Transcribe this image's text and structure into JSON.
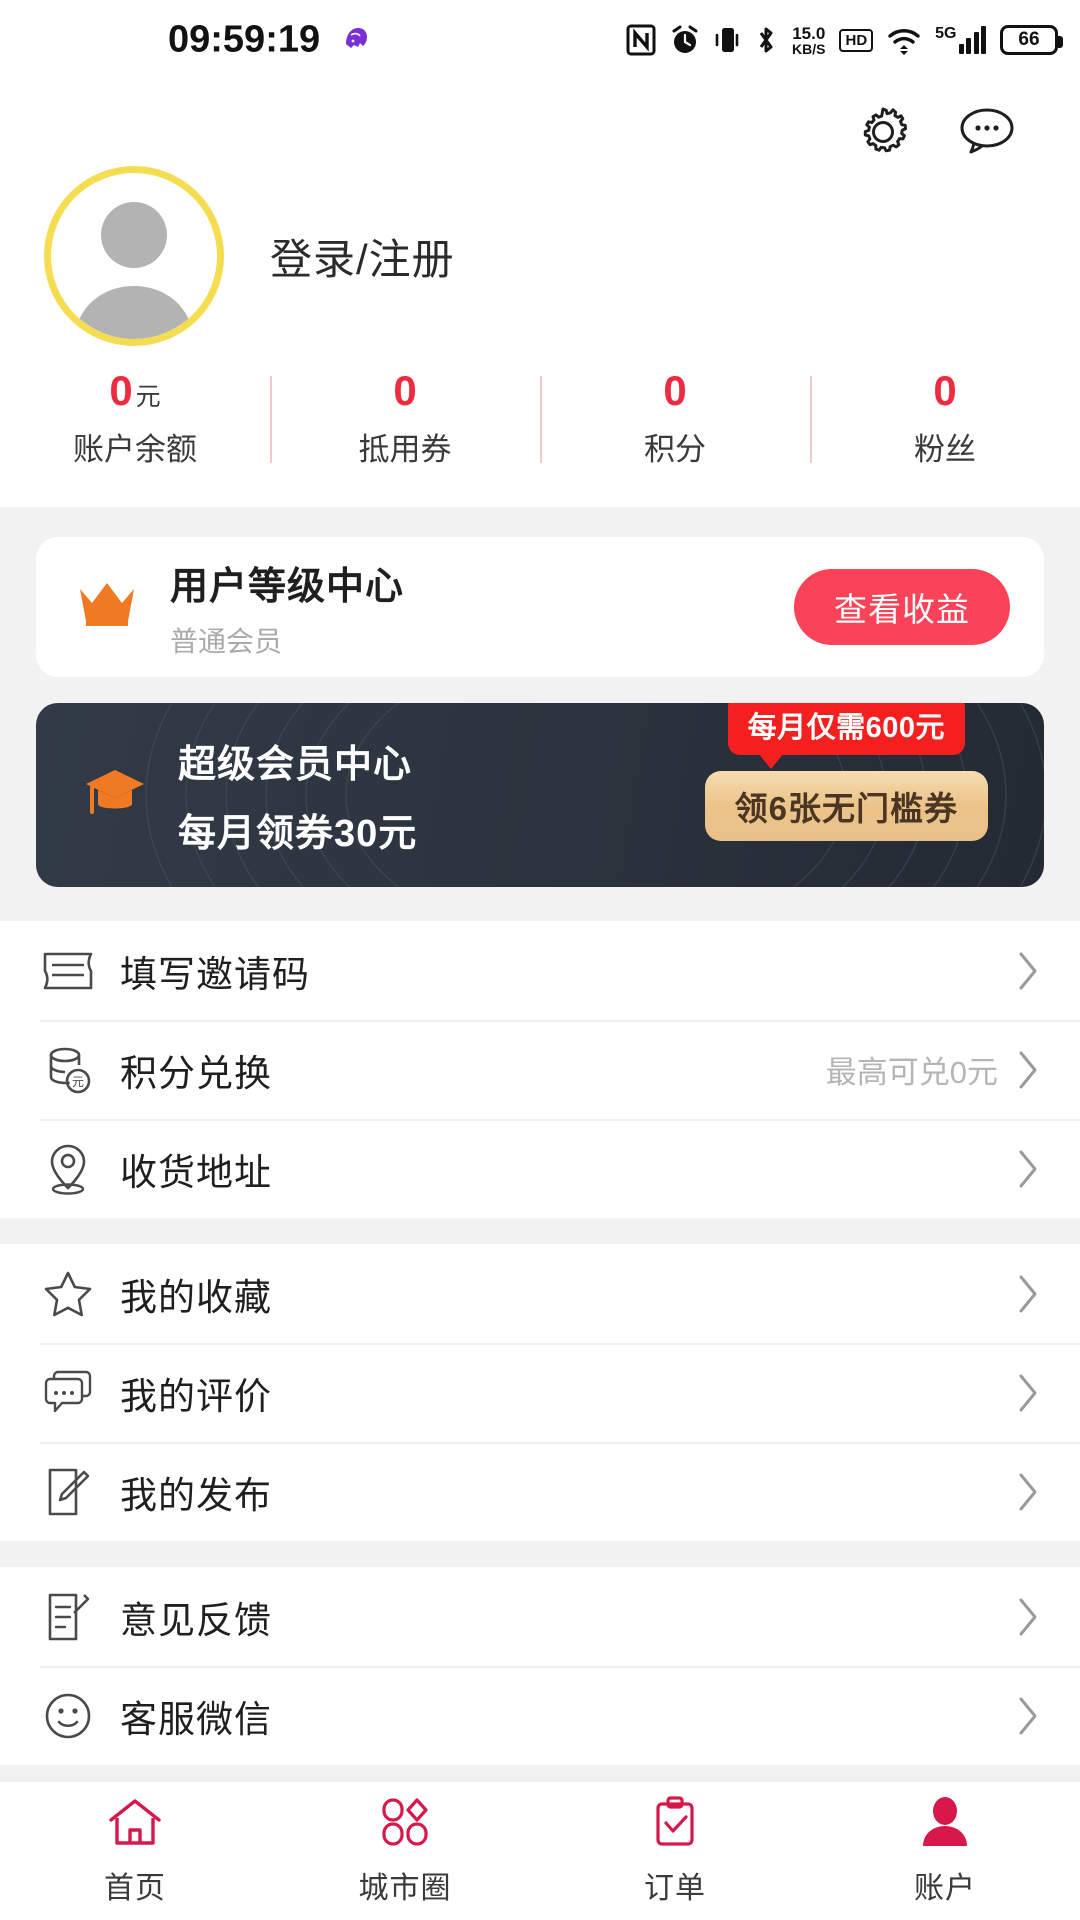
{
  "status_bar": {
    "time": "09:59:19",
    "network_speed_value": "15.0",
    "network_speed_unit": "KB/S",
    "hd_label": "HD",
    "network_type": "5G",
    "battery_level": "66",
    "icons": [
      "nfc-icon",
      "alarm-icon",
      "vibrate-icon",
      "bluetooth-icon",
      "network-speed-icon",
      "hd-icon",
      "wifi-icon",
      "signal-icon",
      "battery-icon"
    ]
  },
  "header": {
    "settings_icon": "gear-icon",
    "message_icon": "chat-bubble-icon",
    "avatar_icon": "default-avatar-icon",
    "login_label": "登录/注册"
  },
  "stats": [
    {
      "value": "0",
      "unit": "元",
      "label": "账户余额"
    },
    {
      "value": "0",
      "unit": "",
      "label": "抵用券"
    },
    {
      "value": "0",
      "unit": "",
      "label": "积分"
    },
    {
      "value": "0",
      "unit": "",
      "label": "粉丝"
    }
  ],
  "level_card": {
    "icon": "crown-icon",
    "title": "用户等级中心",
    "subtitle": "普通会员",
    "button_label": "查看收益"
  },
  "super_card": {
    "icon": "graduation-cap-icon",
    "title": "超级会员中心",
    "subtitle": "每月领券30元",
    "promo_badge": "每月仅需600元",
    "promo_button": "领6张无门槛券"
  },
  "menu_groups": [
    {
      "items": [
        {
          "icon": "ticket-icon",
          "label": "填写邀请码",
          "value": ""
        },
        {
          "icon": "coin-stack-icon",
          "label": "积分兑换",
          "value": "最高可兑0元"
        },
        {
          "icon": "location-pin-icon",
          "label": "收货地址",
          "value": ""
        }
      ]
    },
    {
      "items": [
        {
          "icon": "star-icon",
          "label": "我的收藏",
          "value": ""
        },
        {
          "icon": "comment-icon",
          "label": "我的评价",
          "value": ""
        },
        {
          "icon": "edit-note-icon",
          "label": "我的发布",
          "value": ""
        }
      ]
    },
    {
      "items": [
        {
          "icon": "feedback-icon",
          "label": "意见反馈",
          "value": ""
        },
        {
          "icon": "smiley-icon",
          "label": "客服微信",
          "value": ""
        }
      ]
    }
  ],
  "tabbar": [
    {
      "icon": "home-icon",
      "label": "首页",
      "active": false
    },
    {
      "icon": "city-circle-icon",
      "label": "城市圈",
      "active": false
    },
    {
      "icon": "clipboard-check-icon",
      "label": "订单",
      "active": false
    },
    {
      "icon": "person-icon",
      "label": "账户",
      "active": true
    }
  ],
  "colors": {
    "accent_red": "#ef2b42",
    "button_red": "#fa4258",
    "badge_red": "#f42020",
    "gold": "#ecc48a",
    "avatar_ring": "#f5dd52",
    "crown_orange": "#f07a23",
    "tab_active": "#d6184b",
    "dark_card": "#2c343f"
  }
}
